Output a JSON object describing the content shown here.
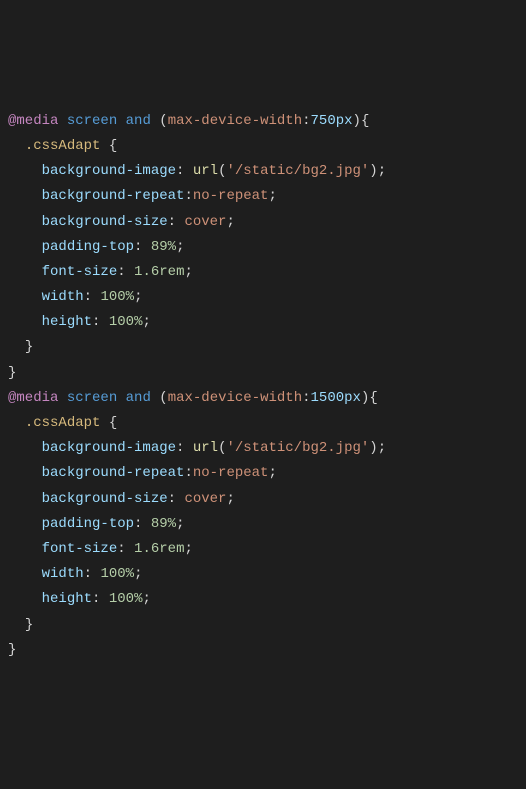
{
  "media1": {
    "at": "@media",
    "screen": "screen",
    "and": "and",
    "feature": "max-device-width",
    "value": "750px"
  },
  "media2": {
    "at": "@media",
    "screen": "screen",
    "and": "and",
    "feature": "max-device-width",
    "value": "1500px"
  },
  "selector": ".cssAdapt",
  "rules": {
    "bgimage_prop": "background-image",
    "url_fn": "url",
    "url_val": "'/static/bg2.jpg'",
    "bgrepeat_prop": "background-repeat",
    "bgrepeat_val": "no-repeat",
    "bgsize_prop": "background-size",
    "bgsize_val": "cover",
    "padtop_prop": "padding-top",
    "padtop_num": "89",
    "padtop_unit": "%",
    "fontsize_prop": "font-size",
    "fontsize_num": "1.6",
    "fontsize_unit": "rem",
    "width_prop": "width",
    "width_num": "100",
    "width_unit": "%",
    "height_prop": "height",
    "height_num": "100",
    "height_unit": "%"
  }
}
